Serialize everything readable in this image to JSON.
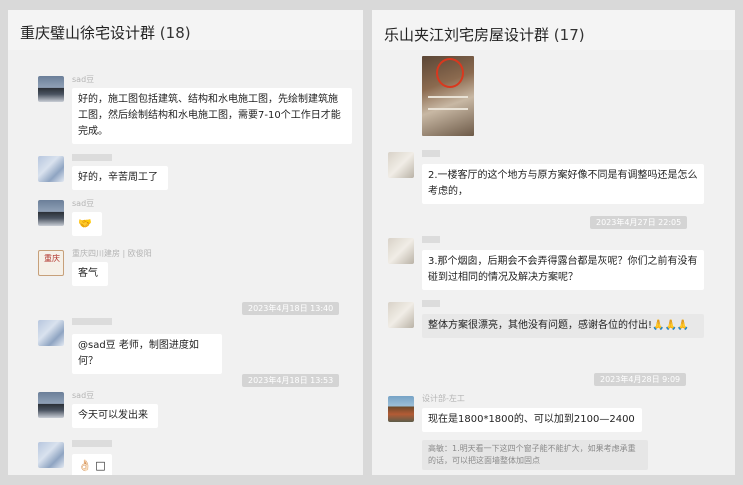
{
  "left": {
    "title": "重庆璧山徐宅设计群",
    "count": "(18)",
    "messages": [
      {
        "nick": "sad豆",
        "text": "好的，施工图包括建筑、结构和水电施工图，先绘制建筑施工图，然后绘制结构和水电施工图，需要7-10个工作日才能完成。"
      },
      {
        "nick": "",
        "text": "好的，辛苦周工了"
      },
      {
        "nick": "sad豆",
        "text": "🤝"
      },
      {
        "nick": "重庆四川建房 | 欧俊阳",
        "text": "客气"
      },
      {
        "time": "2023年4月18日 13:40"
      },
      {
        "nick": "",
        "text": "@sad豆 老师，制图进度如何？"
      },
      {
        "time": "2023年4月18日 13:53"
      },
      {
        "nick": "sad豆",
        "text": "今天可以发出来"
      },
      {
        "nick": "",
        "text": "👌🏻 □"
      }
    ]
  },
  "right": {
    "title": "乐山夹江刘宅房屋设计群",
    "count": "(17)",
    "messages": [
      {
        "nick": "",
        "text": "2.一楼客厅的这个地方与原方案好像不同是有调整吗还是怎么考虑的，"
      },
      {
        "time": "2023年4月27日 22:05"
      },
      {
        "nick": "",
        "text": "3.那个烟囱，后期会不会弄得露台都是灰呢？你们之前有没有碰到过相同的情况及解决方案呢？"
      },
      {
        "nick": "",
        "text": "整体方案很漂亮，其他没有问题，感谢各位的付出!🙏🙏🙏"
      },
      {
        "time": "2023年4月28日 9:09"
      },
      {
        "nick": "设计部-左工",
        "text": "现在是1800*1800的、可以加到2100—2400"
      },
      {
        "quote": "高敏：1.明天看一下这四个窗子能不能扩大，如果考虑承重的话，可以把这面墙整体加固点"
      }
    ]
  },
  "seal_text": "重庆"
}
